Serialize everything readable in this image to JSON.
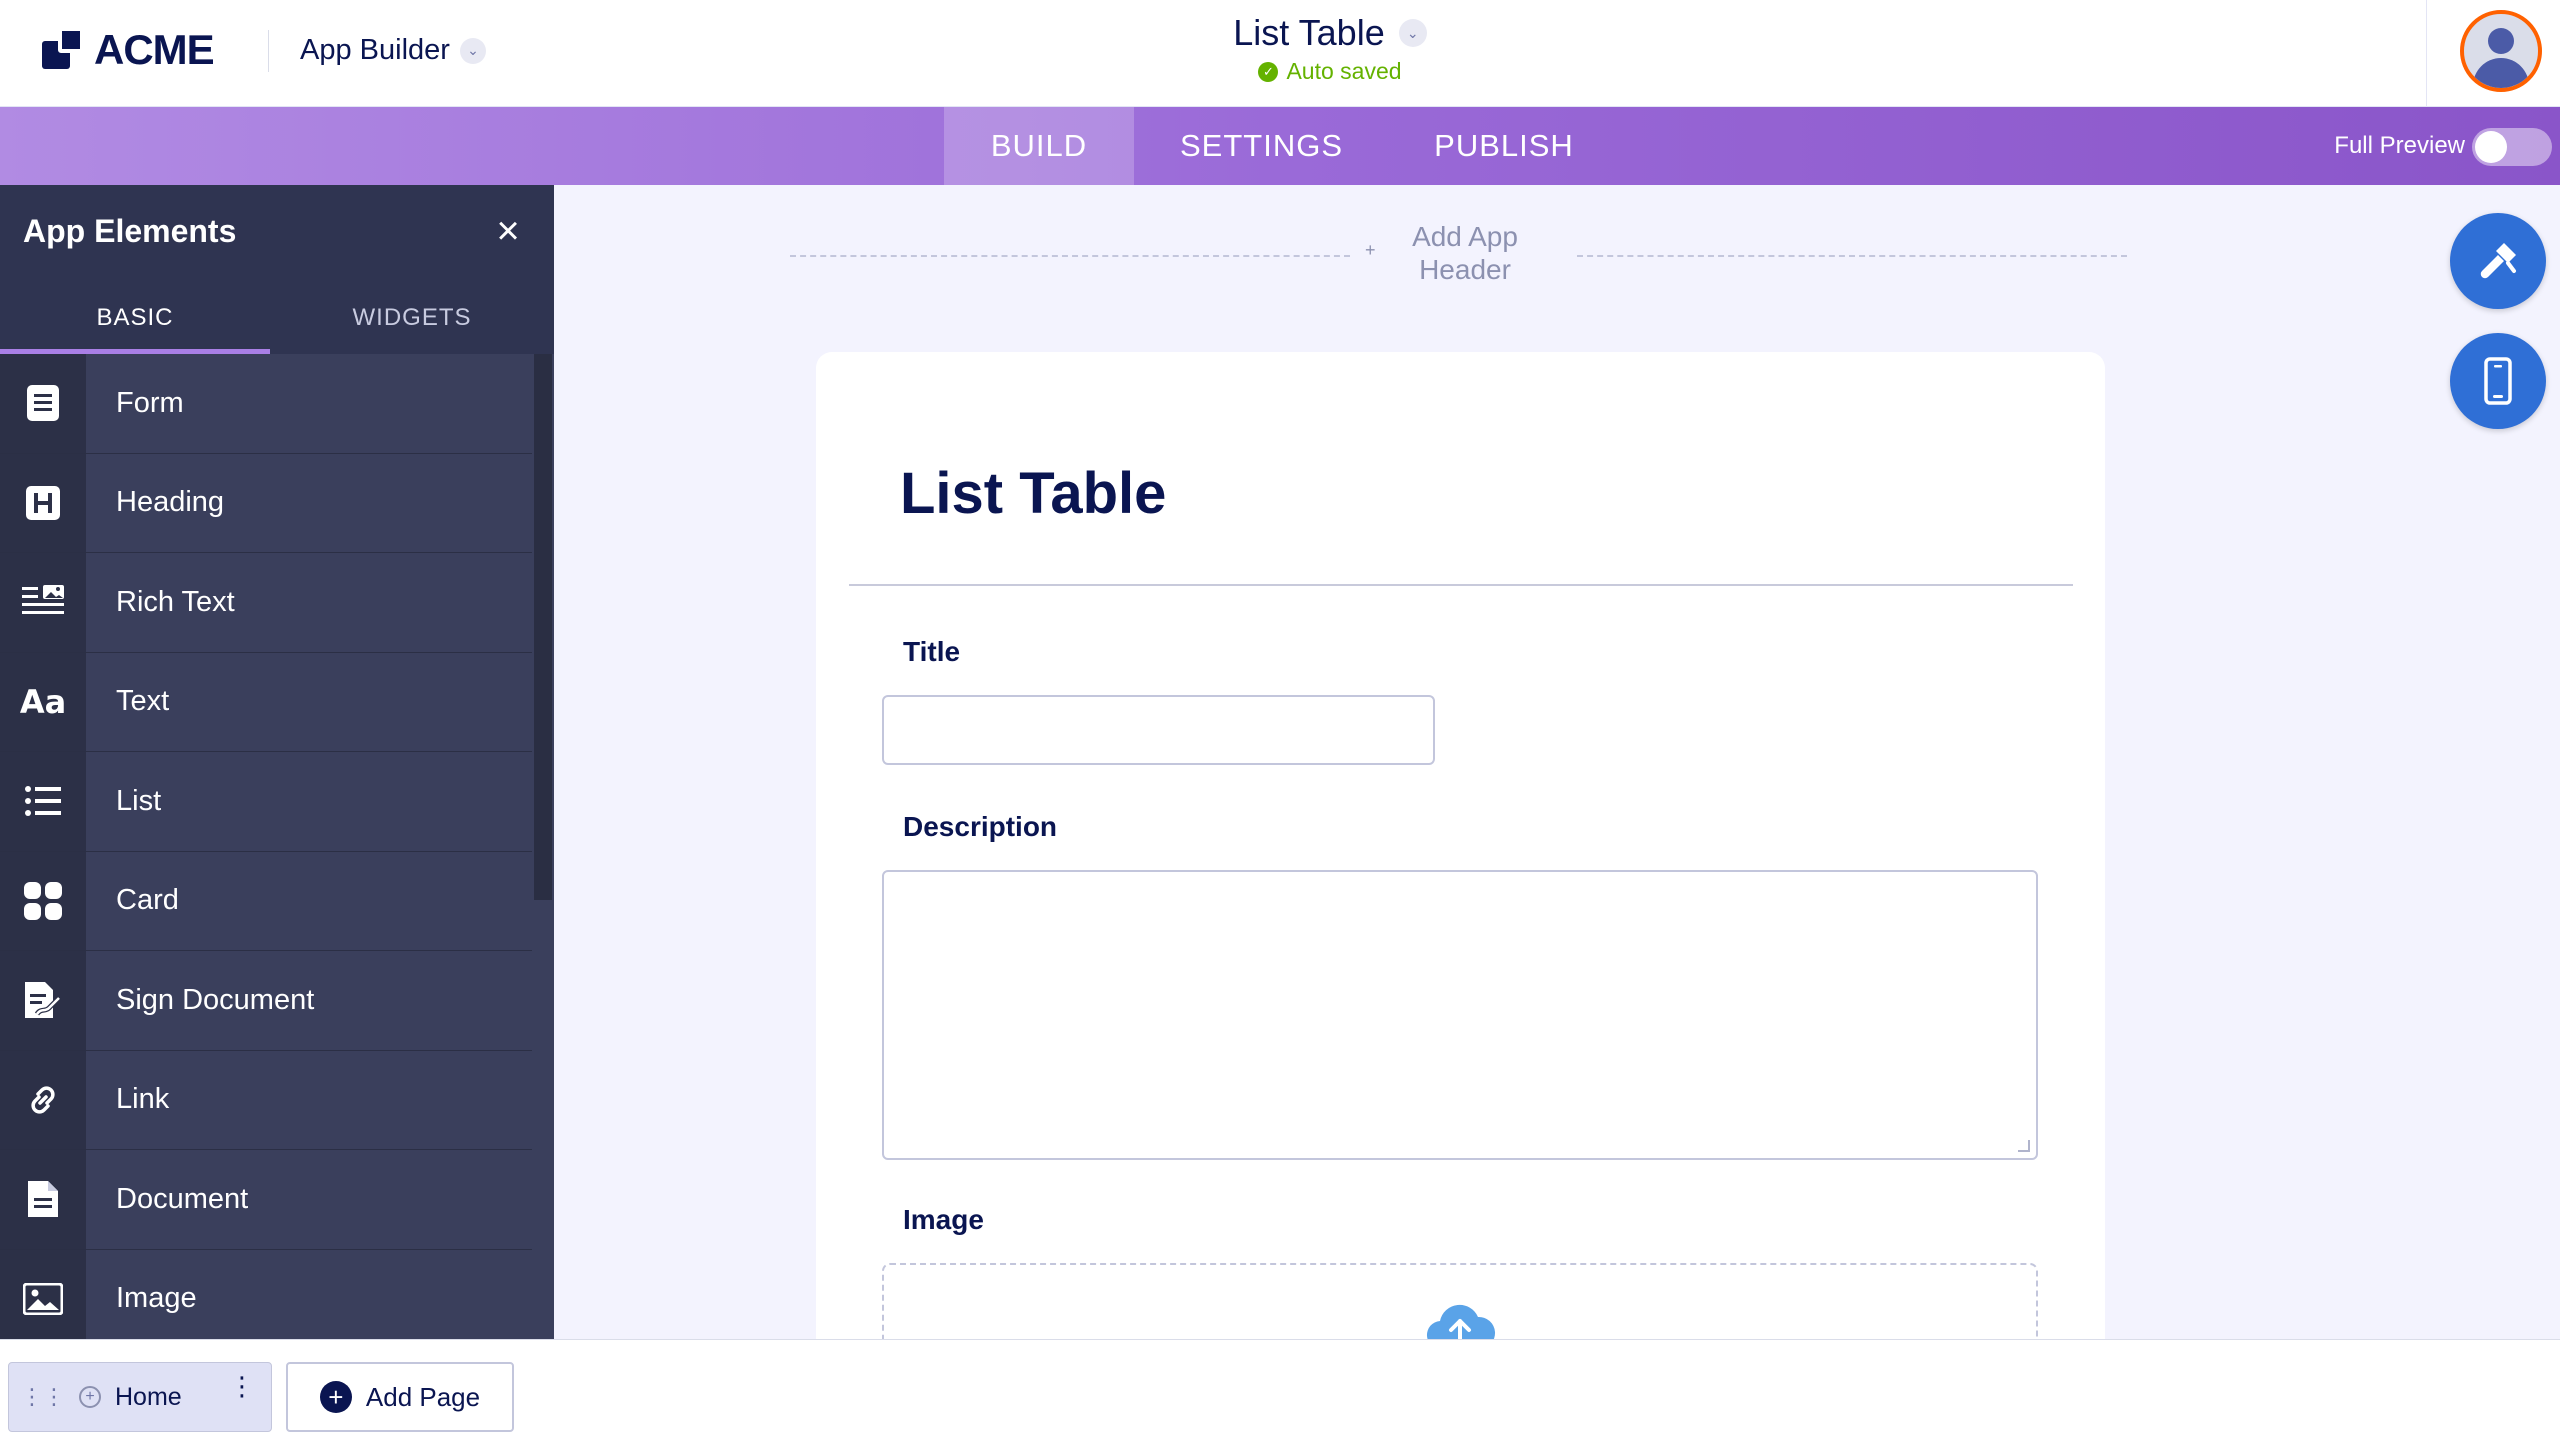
{
  "header": {
    "logo_text": "ACME",
    "app_builder_label": "App Builder",
    "doc_title": "List Table",
    "save_status": "Auto saved"
  },
  "nav": {
    "tabs": [
      {
        "label": "BUILD",
        "active": true
      },
      {
        "label": "SETTINGS",
        "active": false
      },
      {
        "label": "PUBLISH",
        "active": false
      }
    ],
    "full_preview_label": "Full Preview",
    "full_preview_on": false
  },
  "sidebar": {
    "title": "App Elements",
    "tabs": [
      {
        "label": "BASIC",
        "active": true
      },
      {
        "label": "WIDGETS",
        "active": false
      }
    ],
    "items": [
      {
        "label": "Form",
        "icon": "form-icon"
      },
      {
        "label": "Heading",
        "icon": "heading-icon"
      },
      {
        "label": "Rich Text",
        "icon": "rich-text-icon"
      },
      {
        "label": "Text",
        "icon": "text-icon"
      },
      {
        "label": "List",
        "icon": "list-icon"
      },
      {
        "label": "Card",
        "icon": "card-icon"
      },
      {
        "label": "Sign Document",
        "icon": "sign-document-icon"
      },
      {
        "label": "Link",
        "icon": "link-icon"
      },
      {
        "label": "Document",
        "icon": "document-icon"
      },
      {
        "label": "Image",
        "icon": "image-icon"
      }
    ]
  },
  "canvas": {
    "add_header_label": "Add App Header",
    "add_header_line1": "Add App",
    "add_header_line2": "Header",
    "add_header_plus": "+",
    "form_title": "List Table",
    "fields": [
      {
        "label": "Title",
        "value": ""
      },
      {
        "label": "Description",
        "value": ""
      },
      {
        "label": "Image"
      }
    ]
  },
  "footer": {
    "pages": [
      {
        "label": "Home"
      }
    ],
    "add_page_label": "Add Page"
  },
  "colors": {
    "brand_navy": "#0a1551",
    "tab_gradient_start": "#b18be3",
    "tab_gradient_end": "#8a55c9",
    "sidebar_bg": "#3a3f5c",
    "accent_blue": "#2f6fd6",
    "saved_green": "#64b200",
    "avatar_ring": "#ff6100"
  }
}
